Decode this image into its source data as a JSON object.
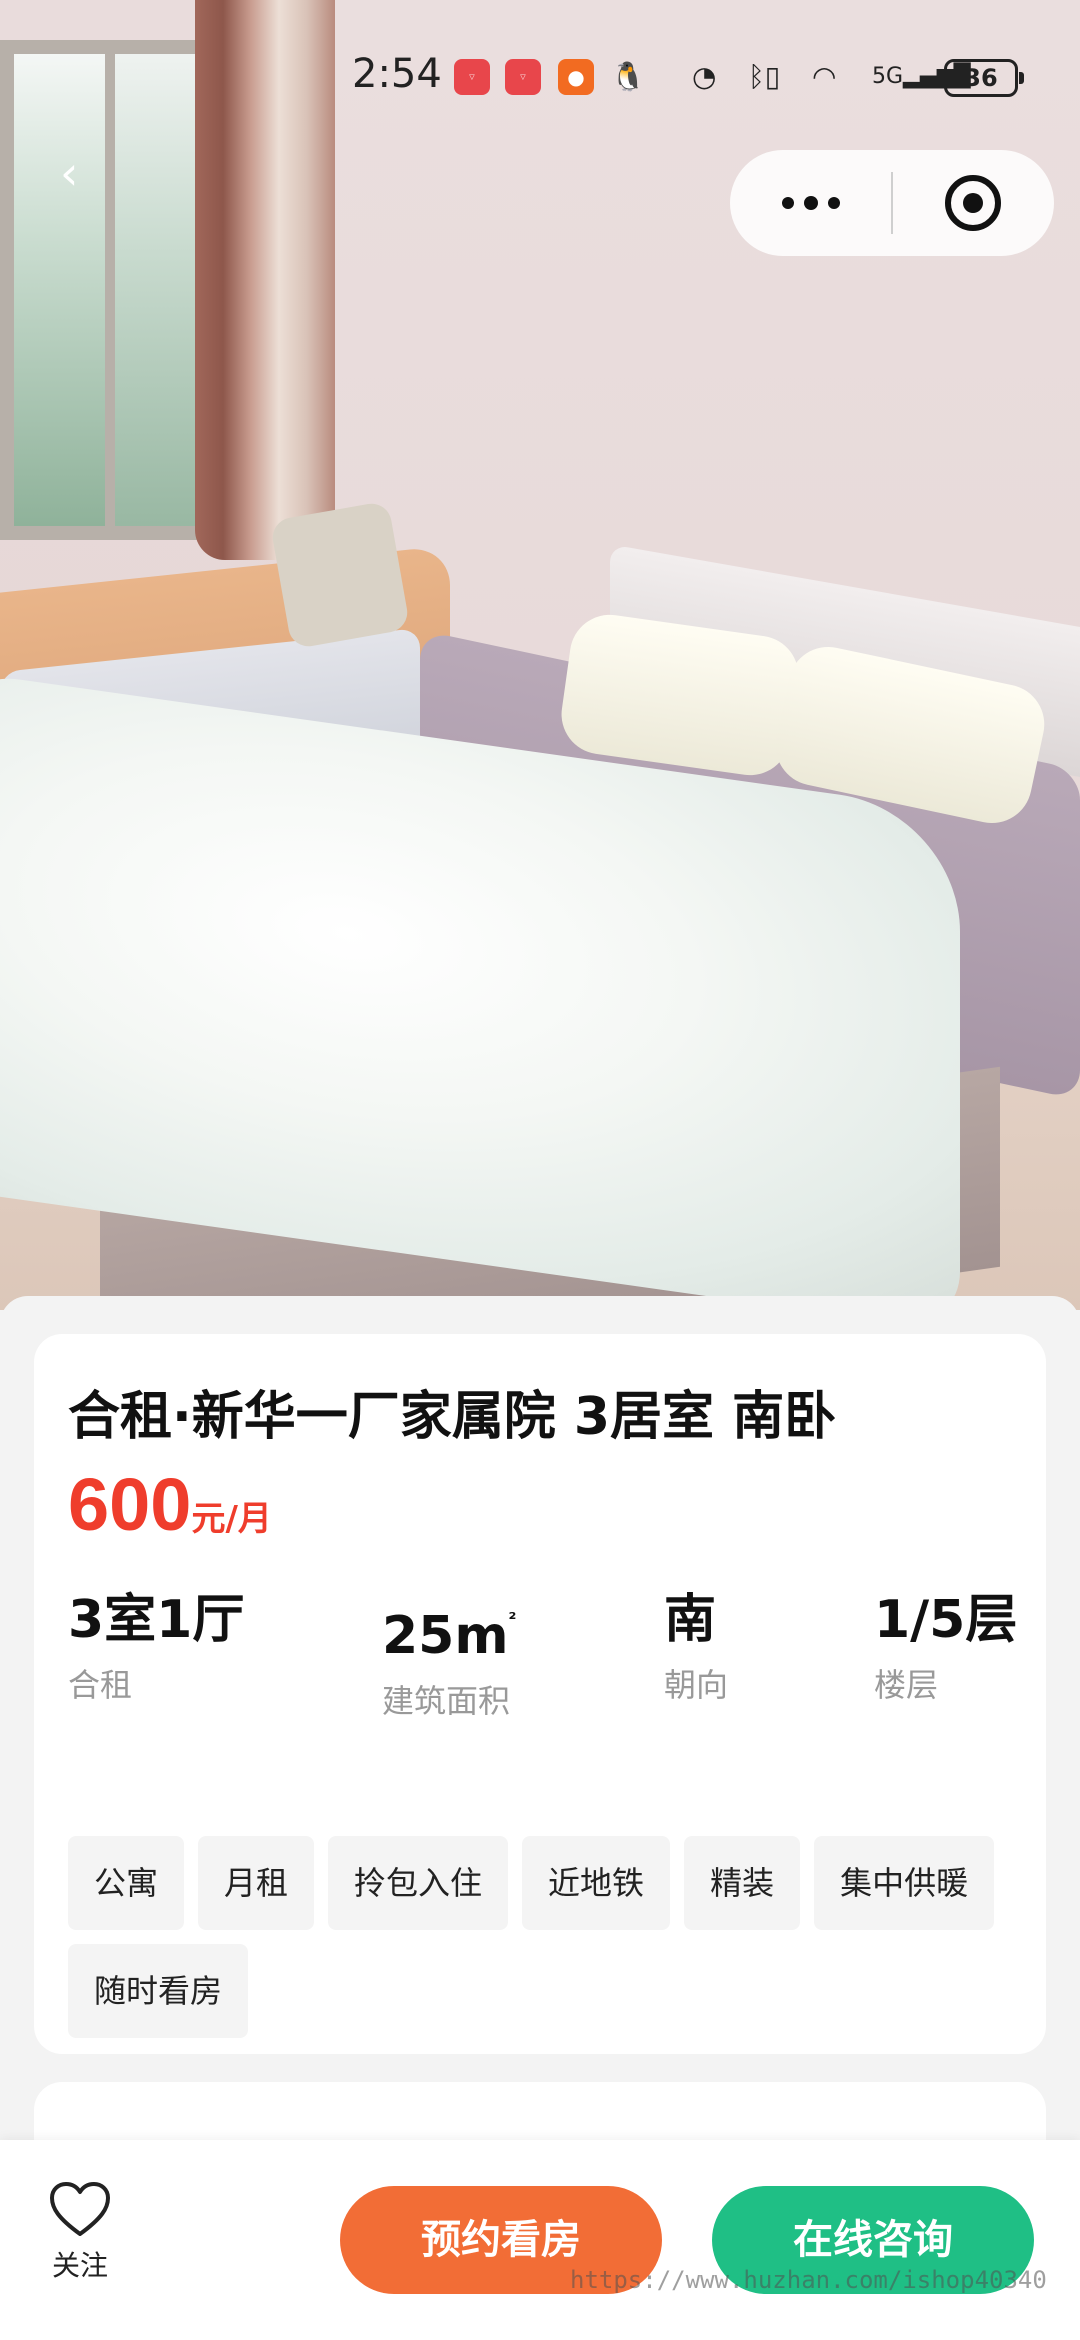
{
  "status_bar": {
    "time": "2:54",
    "battery": "36",
    "notification_icons": [
      "huawei-appgallery-icon",
      "huawei-appgallery-icon",
      "kuaishou-icon",
      "qq-icon"
    ],
    "system_icons": [
      "speed-icon",
      "bluetooth-icon",
      "wifi-icon",
      "signal-5g-icon"
    ]
  },
  "nav": {
    "back_icon": "chevron-left-icon",
    "capsule_icons": [
      "more-dots-icon",
      "close-target-icon"
    ]
  },
  "listing": {
    "title": "合租·新华一厂家属院 3居室 南卧",
    "price": "600",
    "price_unit": "元/月",
    "specs": [
      {
        "value": "3室1厅",
        "label": "合租"
      },
      {
        "value": "25m",
        "sup": "²",
        "label": "建筑面积"
      },
      {
        "value": "南",
        "label": "朝向"
      },
      {
        "value": "1/5层",
        "label": "楼层"
      }
    ],
    "tags": [
      "公寓",
      "月租",
      "拎包入住",
      "近地铁",
      "精装",
      "集中供暖",
      "随时看房"
    ]
  },
  "bottom_bar": {
    "follow_label": "关注",
    "book_label": "预约看房",
    "consult_label": "在线咨询"
  },
  "watermark": "https://www.huzhan.com/ishop40340",
  "colors": {
    "price": "#ef3d2c",
    "book_button": "#f26d36",
    "consult_button": "#1fbf85"
  }
}
